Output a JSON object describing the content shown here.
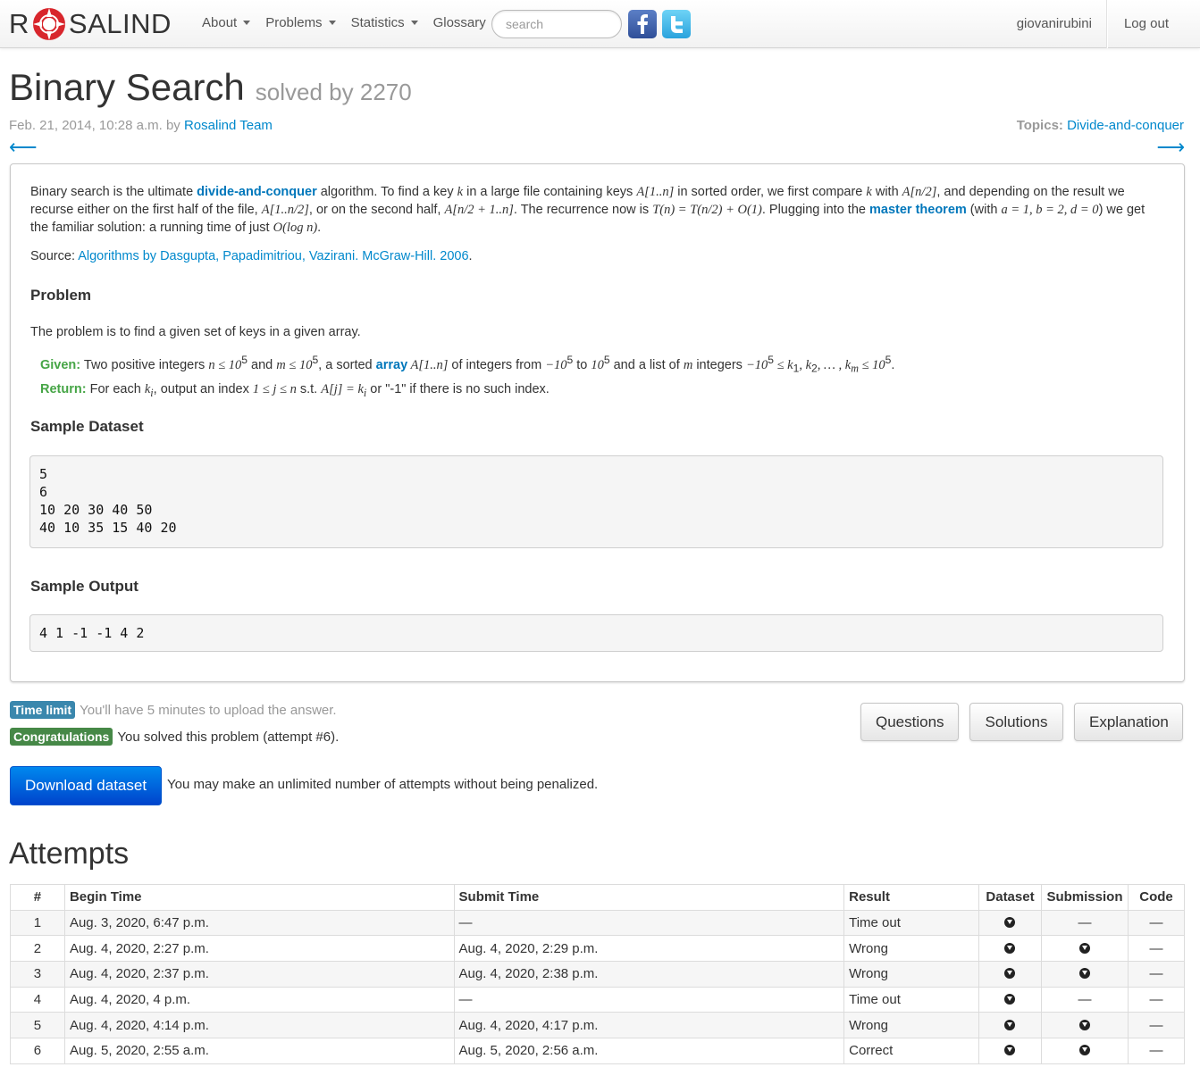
{
  "nav": {
    "brand_left": "R",
    "brand_right": "SALIND",
    "menu": [
      {
        "label": "About",
        "has_caret": true
      },
      {
        "label": "Problems",
        "has_caret": true
      },
      {
        "label": "Statistics",
        "has_caret": true
      },
      {
        "label": "Glossary",
        "has_caret": false
      }
    ],
    "search_placeholder": "search",
    "user": "giovanirubini",
    "logout": "Log out",
    "social_icons": [
      "facebook-icon",
      "twitter-icon"
    ]
  },
  "header": {
    "title": "Binary Search",
    "solved": "solved by 2270",
    "date": "Feb. 21, 2014, 10:28 a.m. by ",
    "author": "Rosalind Team",
    "topics_label": "Topics:",
    "topic": "Divide-and-conquer",
    "prev_arrow": "⟵",
    "next_arrow": "⟶"
  },
  "problem": {
    "intro": {
      "t1": "Binary search is the ultimate ",
      "link1": "divide-and-conquer",
      "t2": " algorithm. To find a key ",
      "t3": " in a large file containing keys ",
      "t4": " in sorted order, we first compare ",
      "t5": " with ",
      "t6": ", and depending on the result we recurse either on the first half of the file, ",
      "t7": ", or on the second half, ",
      "t8": ". The recurrence now is ",
      "t9": ". Plugging into the ",
      "link2": "master theorem",
      "t10": " (with ",
      "t11": ") we get the familiar solution: a running time of just ",
      "t12": "."
    },
    "math": {
      "k": "k",
      "A1n": "A[1..n]",
      "An2": "A[n/2]",
      "A1n2": "A[1..n/2]",
      "An21n": "A[n/2 + 1..n]",
      "recurrence": "T(n) = T(n/2) + O(1)",
      "abd": "a = 1, b = 2, d = 0",
      "logn": "O(log n)"
    },
    "source_label": "Source: ",
    "source_link": "Algorithms by Dasgupta, Papadimitriou, Vazirani. McGraw-Hill. 2006",
    "source_end": ".",
    "problem_heading": "Problem",
    "problem_text": "The problem is to find a given set of keys in a given array.",
    "given": {
      "label": "Given:",
      "t1": " Two positive integers ",
      "m1": "n ≤ 10",
      "sup1": "5",
      "t2": " and ",
      "m2": "m ≤ 10",
      "sup2": "5",
      "t3": ", a sorted ",
      "link": "array",
      "m3": " A[1..n]",
      "t4": " of integers from ",
      "m4": "−10",
      "sup4": "5",
      "t5": " to ",
      "m5": "10",
      "sup5": "5",
      "t6": " and a list of ",
      "m6": "m",
      "t7": " integers ",
      "m7": "−10",
      "sup7": "5",
      "m8": " ≤ k",
      "sub1": "1",
      "m9": ", k",
      "sub2": "2",
      "m10": ", … , k",
      "sub3": "m",
      "m11": " ≤ 10",
      "sup8": "5",
      "t8": "."
    },
    "ret": {
      "label": "Return:",
      "t1": " For each ",
      "m1": "k",
      "sub1": "i",
      "t2": ", output an index ",
      "m2": "1 ≤ j ≤ n",
      "t3": " s.t. ",
      "m3": "A[j] = k",
      "sub2": "i",
      "t4": " or \"-1\" if there is no such index."
    },
    "sample_dataset_heading": "Sample Dataset",
    "sample_dataset": "5\n6\n10 20 30 40 50\n40 10 35 15 40 20",
    "sample_output_heading": "Sample Output",
    "sample_output": "4 1 -1 -1 4 2"
  },
  "status": {
    "time_limit_badge": "Time limit",
    "time_limit_text": "You'll have 5 minutes to upload the answer.",
    "congrats_badge": "Congratulations",
    "congrats_text": "You solved this problem (attempt #6).",
    "buttons": [
      "Questions",
      "Solutions",
      "Explanation"
    ],
    "download": "Download dataset",
    "download_note": "You may make an unlimited number of attempts without being penalized."
  },
  "attempts": {
    "title": "Attempts",
    "columns": [
      "#",
      "Begin Time",
      "Submit Time",
      "Result",
      "Dataset",
      "Submission",
      "Code"
    ],
    "rows": [
      {
        "n": "1",
        "begin": "Aug. 3, 2020, 6:47 p.m.",
        "submit": "—",
        "result": "Time out",
        "dataset": "icon",
        "submission": "—",
        "code": "—"
      },
      {
        "n": "2",
        "begin": "Aug. 4, 2020, 2:27 p.m.",
        "submit": "Aug. 4, 2020, 2:29 p.m.",
        "result": "Wrong",
        "dataset": "icon",
        "submission": "icon",
        "code": "—"
      },
      {
        "n": "3",
        "begin": "Aug. 4, 2020, 2:37 p.m.",
        "submit": "Aug. 4, 2020, 2:38 p.m.",
        "result": "Wrong",
        "dataset": "icon",
        "submission": "icon",
        "code": "—"
      },
      {
        "n": "4",
        "begin": "Aug. 4, 2020, 4 p.m.",
        "submit": "—",
        "result": "Time out",
        "dataset": "icon",
        "submission": "—",
        "code": "—"
      },
      {
        "n": "5",
        "begin": "Aug. 4, 2020, 4:14 p.m.",
        "submit": "Aug. 4, 2020, 4:17 p.m.",
        "result": "Wrong",
        "dataset": "icon",
        "submission": "icon",
        "code": "—"
      },
      {
        "n": "6",
        "begin": "Aug. 5, 2020, 2:55 a.m.",
        "submit": "Aug. 5, 2020, 2:56 a.m.",
        "result": "Correct",
        "dataset": "icon",
        "submission": "icon",
        "code": "—"
      }
    ]
  },
  "colors": {
    "link": "#0088cc",
    "given_label": "#46a546",
    "badge_info": "#3a87ad",
    "badge_success": "#468847",
    "primary_button": "#0055cc"
  }
}
